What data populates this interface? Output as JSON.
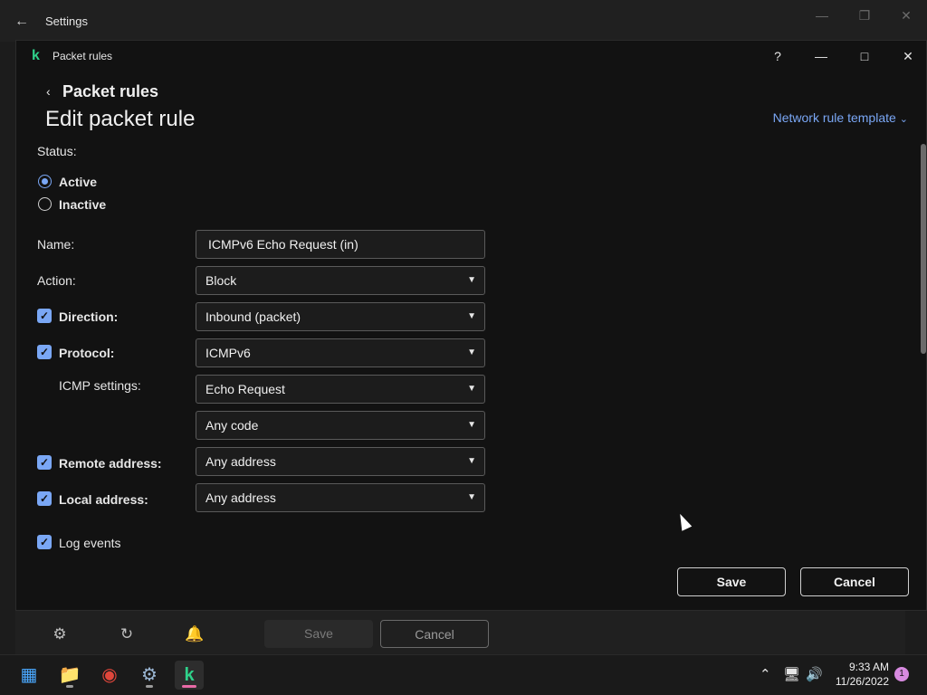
{
  "settings_window": {
    "title": "Settings",
    "back_icon": "back-arrow-icon"
  },
  "dialog": {
    "title": "Packet rules",
    "help": "?",
    "breadcrumb": "Packet rules",
    "page_title": "Edit packet rule",
    "template_link": "Network rule template"
  },
  "form": {
    "status_label": "Status:",
    "status_options": [
      "Active",
      "Inactive"
    ],
    "status_selected": "Active",
    "name_label": "Name:",
    "name_value": "ICMPv6 Echo Request (in)",
    "action_label": "Action:",
    "action_value": "Block",
    "direction_label": "Direction:",
    "direction_checked": true,
    "direction_value": "Inbound (packet)",
    "protocol_label": "Protocol:",
    "protocol_checked": true,
    "protocol_value": "ICMPv6",
    "icmp_label": "ICMP settings:",
    "icmp_type_value": "Echo Request",
    "icmp_code_value": "Any code",
    "remote_label": "Remote address:",
    "remote_checked": true,
    "remote_value": "Any address",
    "local_label": "Local address:",
    "local_checked": true,
    "local_value": "Any address",
    "log_label": "Log events",
    "log_checked": true
  },
  "buttons": {
    "save": "Save",
    "cancel": "Cancel"
  },
  "footer": {
    "save": "Save",
    "cancel": "Cancel"
  },
  "taskbar": {
    "time": "9:33 AM",
    "date": "11/26/2022",
    "notification_count": "1"
  },
  "colors": {
    "accent": "#7aa7f5",
    "kaspersky_green": "#2fd18a",
    "background": "#121212"
  }
}
